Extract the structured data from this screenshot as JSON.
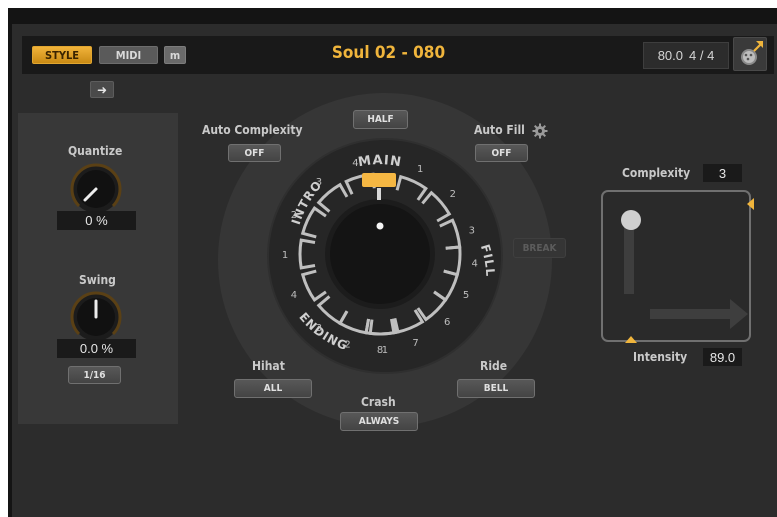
{
  "header": {
    "style_label": "STYLE",
    "midi_label": "MIDI",
    "m_label": "m",
    "preset_title": "Soul 02 - 080",
    "tempo": "80.0",
    "time_signature": "4 / 4"
  },
  "left_panel": {
    "quantize_label": "Quantize",
    "quantize_value": "0 %",
    "swing_label": "Swing",
    "swing_value": "0.0 %",
    "swing_grid": "1/16"
  },
  "center": {
    "half_label": "HALF",
    "auto_complexity_label": "Auto Complexity",
    "auto_complexity_value": "OFF",
    "auto_fill_label": "Auto Fill",
    "auto_fill_value": "OFF",
    "break_label": "BREAK",
    "ring_labels": {
      "main": "MAIN",
      "intro": "INTRO",
      "fill": "FILL",
      "ending": "ENDING"
    },
    "intro_numbers": [
      "1",
      "2",
      "3",
      "4"
    ],
    "main_numbers": [
      "1",
      "2",
      "3",
      "4",
      "5",
      "6",
      "7",
      "8"
    ],
    "ending_numbers": [
      "4",
      "3",
      "2",
      "1"
    ],
    "hihat_label": "Hihat",
    "hihat_value": "ALL",
    "ride_label": "Ride",
    "ride_value": "BELL",
    "crash_label": "Crash",
    "crash_value": "ALWAYS"
  },
  "xy": {
    "complexity_label": "Complexity",
    "complexity_value": "3",
    "intensity_label": "Intensity",
    "intensity_value": "89.0"
  },
  "colors": {
    "accent": "#f0b53c",
    "panel": "#2c2c2c",
    "dark": "#191919"
  },
  "icons": [
    "arrow-right-icon",
    "gear-icon",
    "export-arrow-icon",
    "drum-icon"
  ]
}
